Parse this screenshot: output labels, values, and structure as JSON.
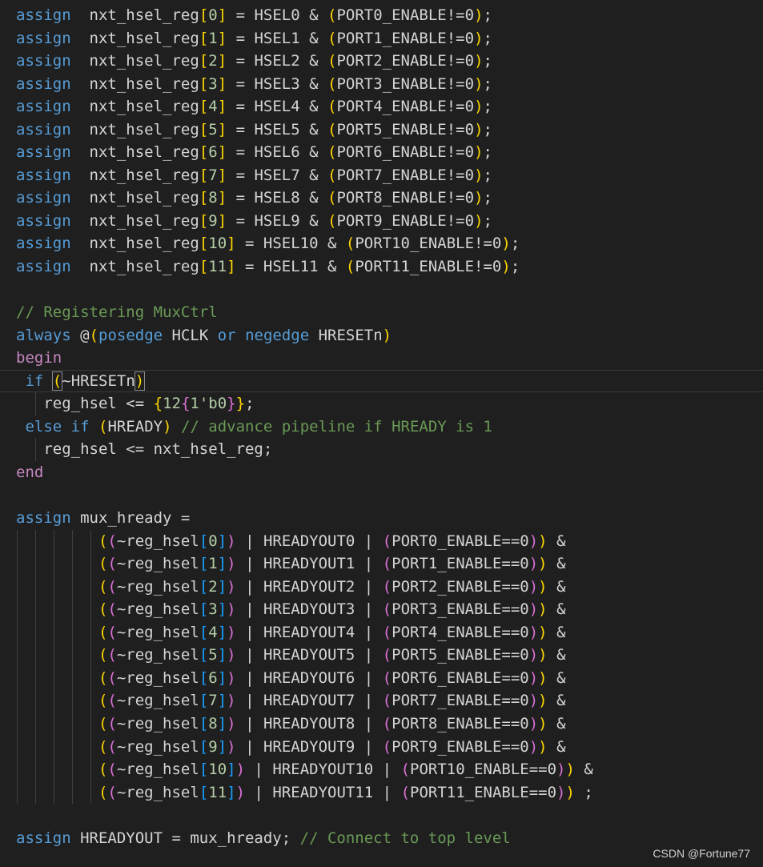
{
  "colors": {
    "background": "#1f1f1f",
    "keyword": "#569cd6",
    "control_keyword": "#c586c0",
    "identifier": "#d4d4d4",
    "number": "#b5cea8",
    "comment": "#6a9955",
    "bracket_1": "#ffd700",
    "bracket_2": "#da70d6",
    "bracket_3": "#179fff"
  },
  "code": {
    "assign_sel": [
      {
        "idx": "0",
        "rhs": " = HSEL0 & ",
        "port": "PORT0_ENABLE!=0"
      },
      {
        "idx": "1",
        "rhs": " = HSEL1 & ",
        "port": "PORT1_ENABLE!=0"
      },
      {
        "idx": "2",
        "rhs": " = HSEL2 & ",
        "port": "PORT2_ENABLE!=0"
      },
      {
        "idx": "3",
        "rhs": " = HSEL3 & ",
        "port": "PORT3_ENABLE!=0"
      },
      {
        "idx": "4",
        "rhs": " = HSEL4 & ",
        "port": "PORT4_ENABLE!=0"
      },
      {
        "idx": "5",
        "rhs": " = HSEL5 & ",
        "port": "PORT5_ENABLE!=0"
      },
      {
        "idx": "6",
        "rhs": " = HSEL6 & ",
        "port": "PORT6_ENABLE!=0"
      },
      {
        "idx": "7",
        "rhs": " = HSEL7 & ",
        "port": "PORT7_ENABLE!=0"
      },
      {
        "idx": "8",
        "rhs": " = HSEL8 & ",
        "port": "PORT8_ENABLE!=0"
      },
      {
        "idx": "9",
        "rhs": " = HSEL9 & ",
        "port": "PORT9_ENABLE!=0"
      },
      {
        "idx": "10",
        "rhs": " = HSEL10 & ",
        "port": "PORT10_ENABLE!=0"
      },
      {
        "idx": "11",
        "rhs": " = HSEL11 & ",
        "port": "PORT11_ENABLE!=0"
      }
    ],
    "kw_assign": "assign",
    "sel_name": "nxt_hsel_reg",
    "comment_registering": "// Registering MuxCtrl",
    "kw_always": "always",
    "at": "@",
    "kw_posedge": "posedge",
    "clk": " HCLK ",
    "kw_or": "or",
    "kw_negedge": "negedge",
    "rst": " HRESETn",
    "kw_begin": "begin",
    "kw_if": "if",
    "cond_rst": "~HRESETn",
    "reg_hsel_assign": "reg_hsel <= ",
    "const_12": "12",
    "const_zero": "1'b0",
    "kw_else_if": "else if",
    "cond_hready": "HREADY",
    "comment_advance": "// advance pipeline if HREADY is 1",
    "reg_hsel_next": "reg_hsel <= nxt_hsel_reg;",
    "kw_end": "end",
    "mux_lhs": " mux_hready =",
    "mux_terms": [
      {
        "idx": "0",
        "out": "HREADYOUT0",
        "port": "PORT0_ENABLE==0",
        "tail": " &"
      },
      {
        "idx": "1",
        "out": "HREADYOUT1",
        "port": "PORT1_ENABLE==0",
        "tail": " &"
      },
      {
        "idx": "2",
        "out": "HREADYOUT2",
        "port": "PORT2_ENABLE==0",
        "tail": " &"
      },
      {
        "idx": "3",
        "out": "HREADYOUT3",
        "port": "PORT3_ENABLE==0",
        "tail": " &"
      },
      {
        "idx": "4",
        "out": "HREADYOUT4",
        "port": "PORT4_ENABLE==0",
        "tail": " &"
      },
      {
        "idx": "5",
        "out": "HREADYOUT5",
        "port": "PORT5_ENABLE==0",
        "tail": " &"
      },
      {
        "idx": "6",
        "out": "HREADYOUT6",
        "port": "PORT6_ENABLE==0",
        "tail": " &"
      },
      {
        "idx": "7",
        "out": "HREADYOUT7",
        "port": "PORT7_ENABLE==0",
        "tail": " &"
      },
      {
        "idx": "8",
        "out": "HREADYOUT8",
        "port": "PORT8_ENABLE==0",
        "tail": " &"
      },
      {
        "idx": "9",
        "out": "HREADYOUT9",
        "port": "PORT9_ENABLE==0",
        "tail": " &"
      },
      {
        "idx": "10",
        "out": "HREADYOUT10",
        "port": "PORT10_ENABLE==0",
        "tail": " &"
      },
      {
        "idx": "11",
        "out": "HREADYOUT11",
        "port": "PORT11_ENABLE==0",
        "tail": " ;"
      }
    ],
    "final_assign": " HREADYOUT = mux_hready; ",
    "comment_connect": "// Connect to top level"
  },
  "watermark": "CSDN @Fortune77"
}
